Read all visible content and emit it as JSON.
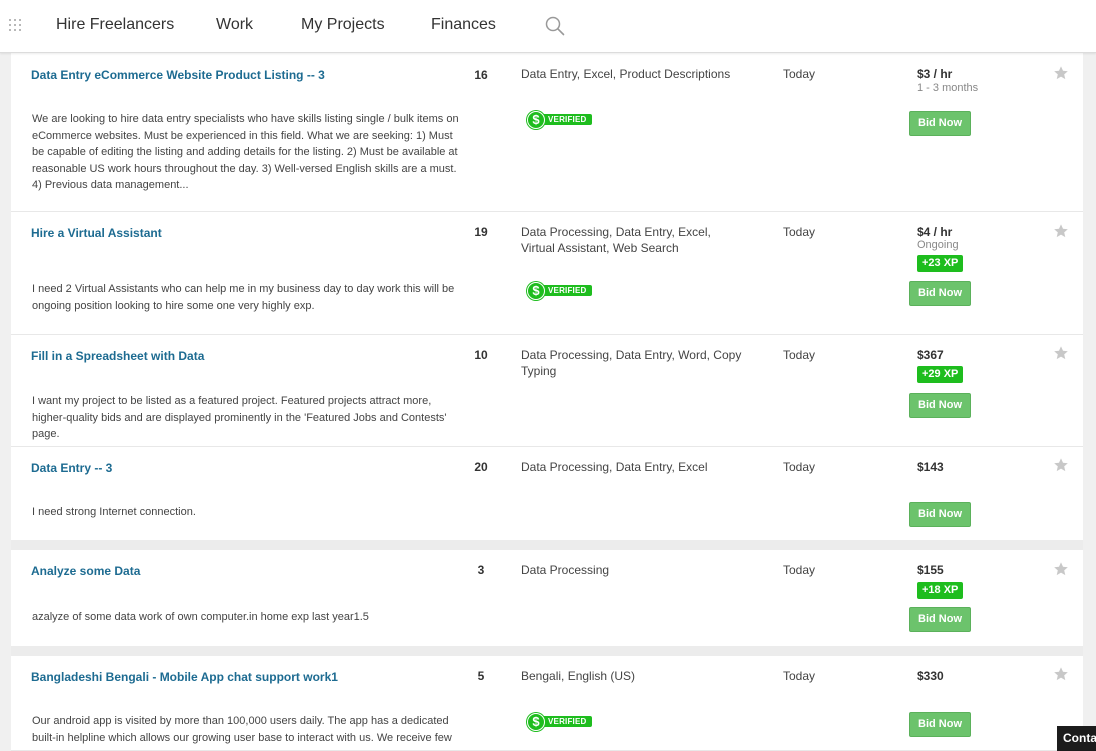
{
  "nav": {
    "items": [
      "Hire Freelancers",
      "Work",
      "My Projects",
      "Finances"
    ],
    "search_icon": "search-icon",
    "apps_icon": "grid-icon"
  },
  "projects": [
    {
      "title": "Data Entry eCommerce Website Product Listing -- 3",
      "bids": "16",
      "skills": "Data Entry,  Excel,  Product Descriptions",
      "date": "Today",
      "price": "$3 / hr",
      "duration": "1 - 3 months",
      "xp": "",
      "description": "We are looking to hire data entry specialists who have skills listing single / bulk items on eCommerce websites. Must be experienced in this field. What we are seeking: 1) Must be capable of editing the listing and adding details for the listing. 2) Must be available at reasonable US work hours throughout the day. 3) Well-versed English skills are a must. 4) Previous data management...",
      "verified": "VERIFIED",
      "bid_label": "Bid Now"
    },
    {
      "title": "Hire a Virtual Assistant",
      "bids": "19",
      "skills": "Data Processing,  Data Entry,  Excel,  Virtual Assistant,  Web Search",
      "date": "Today",
      "price": "$4 / hr",
      "duration": "Ongoing",
      "xp": "+23 XP",
      "description": "I need 2 Virtual Assistants who can help me in my business day to day work this will be ongoing position looking to hire some one very highly exp.",
      "verified": "VERIFIED",
      "bid_label": "Bid Now"
    },
    {
      "title": "Fill in a Spreadsheet with Data",
      "bids": "10",
      "skills": "Data Processing,  Data Entry,  Word,  Copy Typing",
      "date": "Today",
      "price": "$367",
      "duration": "",
      "xp": "+29 XP",
      "description": "I want my project to be listed as a featured project. Featured projects attract more, higher-quality bids and are displayed prominently in the 'Featured Jobs and Contests' page.",
      "verified": "",
      "bid_label": "Bid Now"
    },
    {
      "title": "Data Entry -- 3",
      "bids": "20",
      "skills": "Data Processing,  Data Entry,  Excel",
      "date": "Today",
      "price": "$143",
      "duration": "",
      "xp": "",
      "description": "I need strong Internet connection.",
      "verified": "",
      "bid_label": "Bid Now"
    },
    {
      "title": "Analyze some Data",
      "bids": "3",
      "skills": "Data Processing",
      "date": "Today",
      "price": "$155",
      "duration": "",
      "xp": "+18 XP",
      "description": "azalyze of some data work of own computer.in home exp last year1.5",
      "verified": "",
      "bid_label": "Bid Now"
    },
    {
      "title": "Bangladeshi Bengali - Mobile App chat support work1",
      "bids": "5",
      "skills": "Bengali,  English (US)",
      "date": "Today",
      "price": "$330",
      "duration": "",
      "xp": "",
      "description": "Our android app is visited by more than 100,000 users daily. The app has a dedicated built-in helpline which allows our growing user base to interact with us. We receive few",
      "verified": "VERIFIED",
      "bid_label": "Bid Now"
    }
  ],
  "contact_tab": "Conta",
  "colors": {
    "link": "#1d6b91",
    "xp_badge": "#1ebd1e",
    "bid_button": "#6cc36c",
    "verified": "#1ebd1e"
  }
}
